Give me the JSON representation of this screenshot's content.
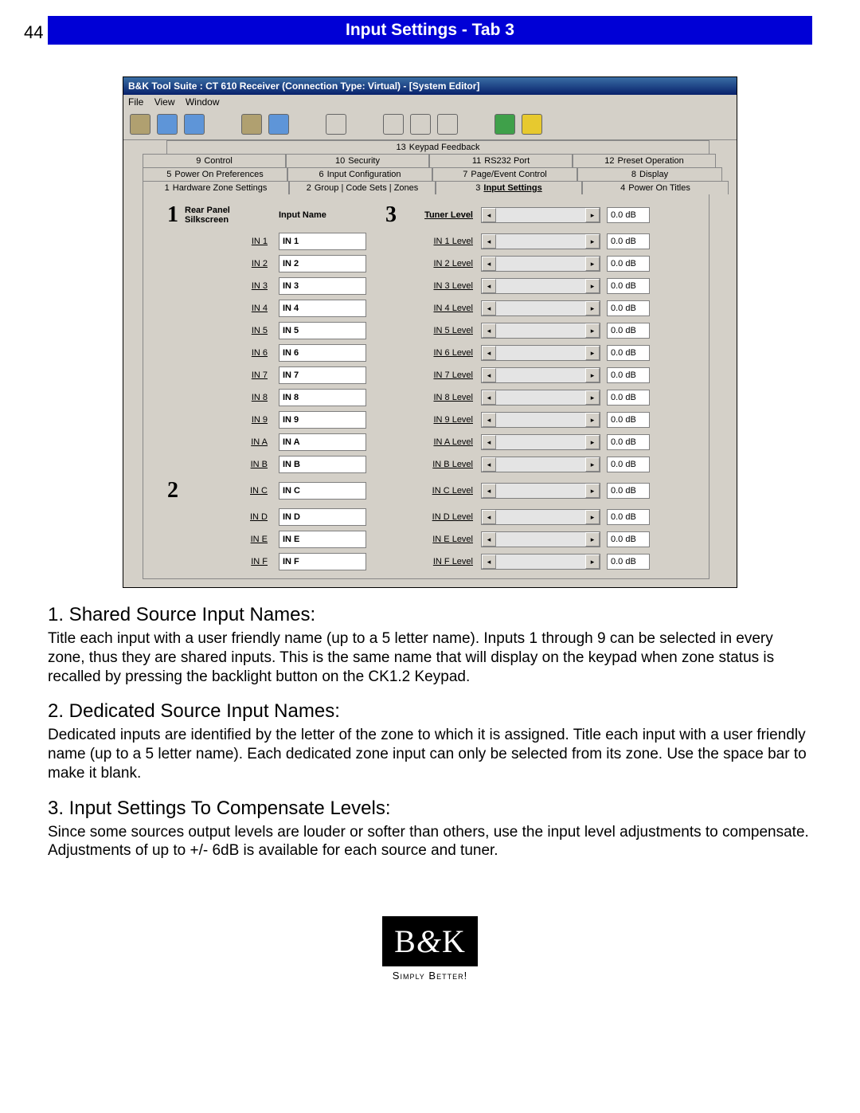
{
  "page_number": "44",
  "page_title": "Input Settings - Tab 3",
  "window": {
    "title": "B&K Tool Suite : CT 610 Receiver (Connection Type: Virtual) - [System Editor]",
    "menus": [
      "File",
      "View",
      "Window"
    ]
  },
  "tabs": {
    "row3": [
      {
        "num": "13",
        "label": "Keypad Feedback"
      }
    ],
    "row2": [
      {
        "num": "9",
        "label": "Control"
      },
      {
        "num": "10",
        "label": "Security"
      },
      {
        "num": "11",
        "label": "RS232 Port"
      },
      {
        "num": "12",
        "label": "Preset Operation"
      }
    ],
    "row1": [
      {
        "num": "5",
        "label": "Power On Preferences"
      },
      {
        "num": "6",
        "label": "Input Configuration"
      },
      {
        "num": "7",
        "label": "Page/Event Control"
      },
      {
        "num": "8",
        "label": "Display"
      }
    ],
    "row0": [
      {
        "num": "1",
        "label": "Hardware Zone Settings"
      },
      {
        "num": "2",
        "label": "Group | Code Sets | Zones"
      },
      {
        "num": "3",
        "label": "Input Settings",
        "active": true
      },
      {
        "num": "4",
        "label": "Power On Titles"
      }
    ]
  },
  "grid_headers": {
    "silkscreen": "Rear Panel Silkscreen",
    "input_name": "Input Name",
    "tuner_level": "Tuner Level"
  },
  "callouts": {
    "one": "1",
    "two": "2",
    "three": "3"
  },
  "rows": [
    {
      "silk": "IN 1",
      "name": "IN 1",
      "level_label": "IN 1 Level",
      "db": "0.0 dB"
    },
    {
      "silk": "IN 2",
      "name": "IN 2",
      "level_label": "IN 2 Level",
      "db": "0.0 dB"
    },
    {
      "silk": "IN 3",
      "name": "IN 3",
      "level_label": "IN 3 Level",
      "db": "0.0 dB"
    },
    {
      "silk": "IN 4",
      "name": "IN 4",
      "level_label": "IN 4 Level",
      "db": "0.0 dB"
    },
    {
      "silk": "IN 5",
      "name": "IN 5",
      "level_label": "IN 5 Level",
      "db": "0.0 dB"
    },
    {
      "silk": "IN 6",
      "name": "IN 6",
      "level_label": "IN 6 Level",
      "db": "0.0 dB"
    },
    {
      "silk": "IN 7",
      "name": "IN 7",
      "level_label": "IN 7 Level",
      "db": "0.0 dB"
    },
    {
      "silk": "IN 8",
      "name": "IN 8",
      "level_label": "IN 8 Level",
      "db": "0.0 dB"
    },
    {
      "silk": "IN 9",
      "name": "IN 9",
      "level_label": "IN 9 Level",
      "db": "0.0 dB"
    },
    {
      "silk": "IN A",
      "name": "IN A",
      "level_label": "IN A Level",
      "db": "0.0 dB"
    },
    {
      "silk": "IN B",
      "name": "IN B",
      "level_label": "IN B Level",
      "db": "0.0 dB"
    },
    {
      "silk": "IN C",
      "name": "IN C",
      "level_label": "IN C Level",
      "db": "0.0 dB"
    },
    {
      "silk": "IN D",
      "name": "IN D",
      "level_label": "IN D Level",
      "db": "0.0 dB"
    },
    {
      "silk": "IN E",
      "name": "IN E",
      "level_label": "IN E Level",
      "db": "0.0 dB"
    },
    {
      "silk": "IN F",
      "name": "IN F",
      "level_label": "IN F Level",
      "db": "0.0 dB"
    }
  ],
  "header_tuner_db": "0.0 dB",
  "sections": {
    "s1": {
      "title": "1. Shared Source Input Names:",
      "body": "Title each input with a user friendly name (up to a 5 letter name). Inputs 1 through 9 can be selected in every zone, thus they are shared inputs.  This is the same name that will display on the keypad when zone status is recalled by pressing the backlight button on the CK1.2 Keypad."
    },
    "s2": {
      "title": "2. Dedicated Source Input Names:",
      "body": "Dedicated inputs are identified by the letter of the zone to which it is assigned.  Title each input with a user friendly name (up to a 5 letter name).  Each dedicated zone input can only be selected from its zone. Use the space bar to make it blank."
    },
    "s3": {
      "title": "3. Input Settings To Compensate Levels:",
      "body": "Since some sources output levels are louder or softer than others, use the input level adjustments to compensate.  Adjustments of up to +/- 6dB is available for each source and tuner."
    }
  },
  "footer": {
    "brand": "B&K",
    "tag": "Simply Better!"
  }
}
